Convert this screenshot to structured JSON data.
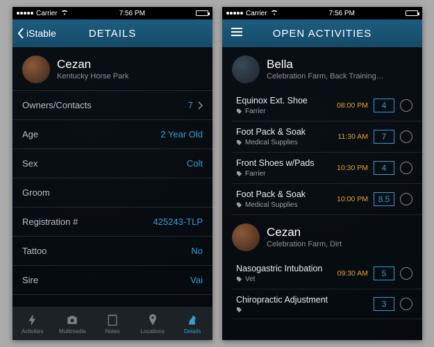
{
  "statusbar": {
    "carrier": "Carrier",
    "wifi_icon": "wifi",
    "time": "7:56 PM"
  },
  "left": {
    "back_label": "iStable",
    "title": "DETAILS",
    "horse": {
      "name": "Cezan",
      "location": "Kentucky Horse Park"
    },
    "rows": [
      {
        "label": "Owners/Contacts",
        "value": "7",
        "chevron": true
      },
      {
        "label": "Age",
        "value": "2 Year Old"
      },
      {
        "label": "Sex",
        "value": "Colt"
      },
      {
        "label": "Groom",
        "value": ""
      },
      {
        "label": "Registration #",
        "value": "425243-TLP"
      },
      {
        "label": "Tattoo",
        "value": "No"
      },
      {
        "label": "Sire",
        "value": "Vai"
      }
    ],
    "tabs": [
      {
        "label": "Activities"
      },
      {
        "label": "Multimedia"
      },
      {
        "label": "Notes"
      },
      {
        "label": "Locations"
      },
      {
        "label": "Details"
      }
    ]
  },
  "right": {
    "title": "OPEN ACTIVITIES",
    "sections": [
      {
        "horse": {
          "name": "Bella",
          "location": "Celebration Farm, Back Training…"
        },
        "acts": [
          {
            "title": "Equinox Ext. Shoe",
            "cat": "Farrier",
            "time": "08:00 PM",
            "val": "4"
          },
          {
            "title": "Foot Pack & Soak",
            "cat": "Medical Supplies",
            "time": "11:30 AM",
            "val": "7"
          },
          {
            "title": "Front Shoes w/Pads",
            "cat": "Farrier",
            "time": "10:30 PM",
            "val": "4"
          },
          {
            "title": "Foot Pack & Soak",
            "cat": "Medical Supplies",
            "time": "10:00 PM",
            "val": "8.5"
          }
        ]
      },
      {
        "horse": {
          "name": "Cezan",
          "location": "Celebration Farm, Dirt"
        },
        "acts": [
          {
            "title": "Nasogastric Intubation",
            "cat": "Vet",
            "time": "09:30 AM",
            "val": "5"
          },
          {
            "title": "Chiropractic Adjustment",
            "cat": "",
            "time": "",
            "val": "3"
          }
        ]
      }
    ]
  }
}
